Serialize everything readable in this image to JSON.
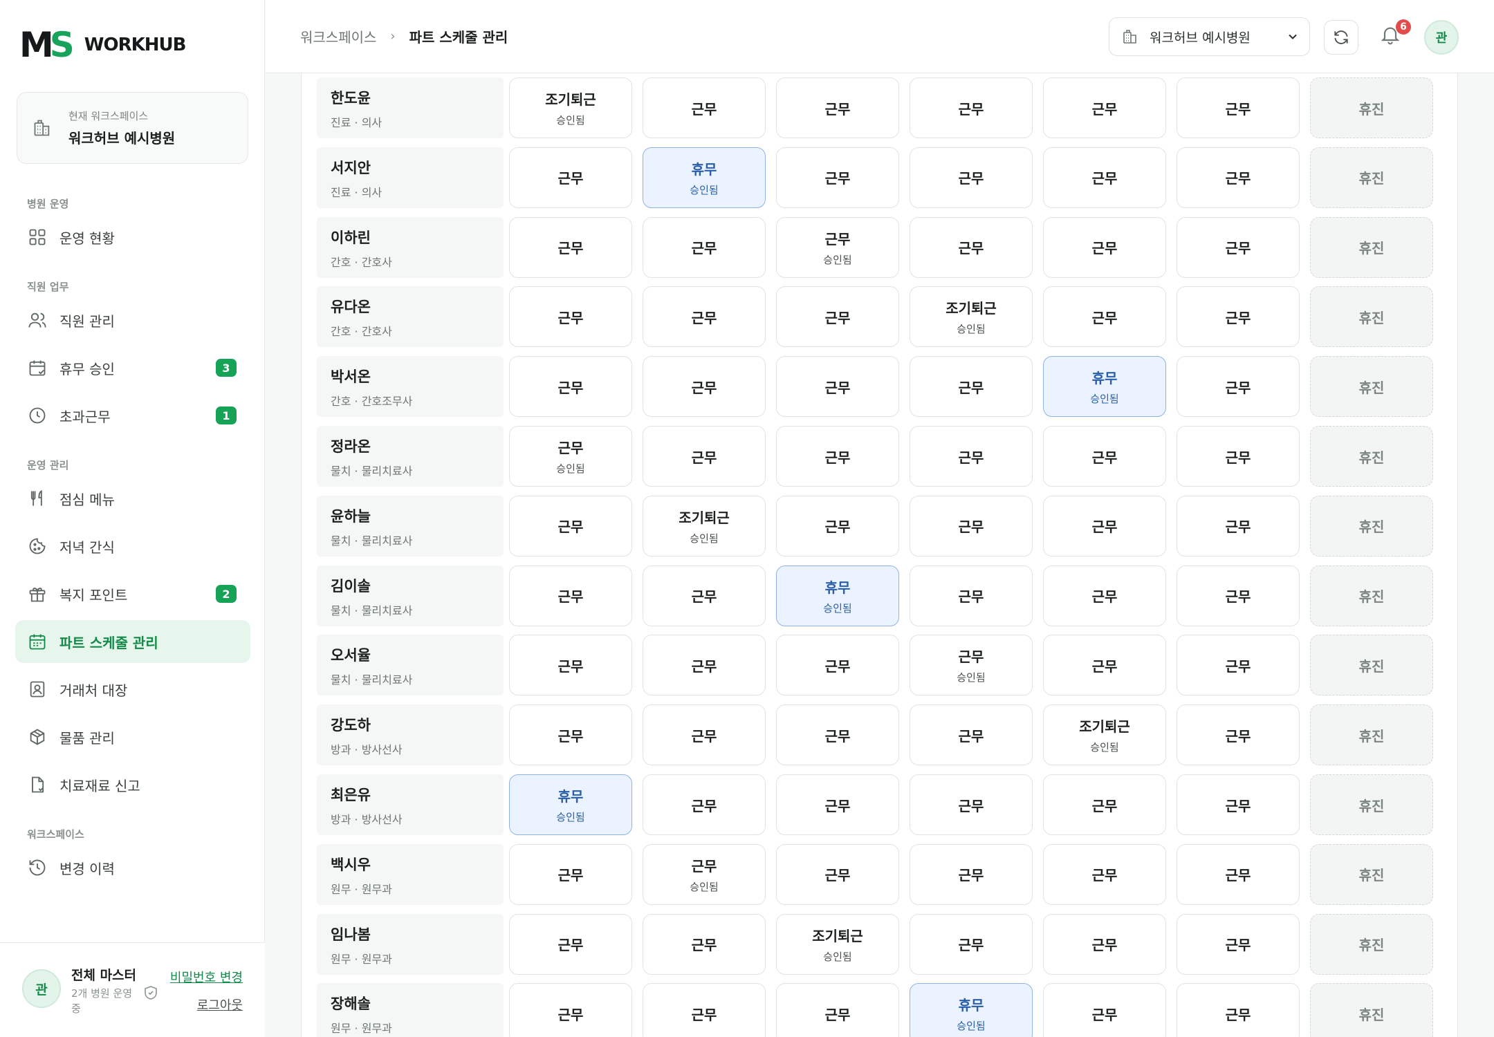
{
  "app": {
    "logo_mark_m": "M",
    "logo_mark_s": "S",
    "logo_text": "WORKHUB"
  },
  "workspace_card": {
    "label": "현재 워크스페이스",
    "value": "워크허브 예시병원"
  },
  "nav": {
    "sections": [
      {
        "title": "병원 운영",
        "items": [
          {
            "key": "dashboard",
            "label": "운영 현황",
            "icon": "grid-icon"
          }
        ]
      },
      {
        "title": "직원 업무",
        "items": [
          {
            "key": "staff",
            "label": "직원 관리",
            "icon": "users-icon"
          },
          {
            "key": "leave",
            "label": "휴무 승인",
            "icon": "calendar-check-icon",
            "badge": "3"
          },
          {
            "key": "overtime",
            "label": "초과근무",
            "icon": "clock-icon",
            "badge": "1"
          }
        ]
      },
      {
        "title": "운영 관리",
        "items": [
          {
            "key": "lunch",
            "label": "점심 메뉴",
            "icon": "utensils-icon"
          },
          {
            "key": "snack",
            "label": "저녁 간식",
            "icon": "cookie-icon"
          },
          {
            "key": "points",
            "label": "복지 포인트",
            "icon": "gift-icon",
            "badge": "2"
          },
          {
            "key": "schedule",
            "label": "파트 스케줄 관리",
            "icon": "calendar-icon",
            "active": true
          },
          {
            "key": "vendors",
            "label": "거래처 대장",
            "icon": "contact-book-icon"
          },
          {
            "key": "supplies",
            "label": "물품 관리",
            "icon": "package-icon"
          },
          {
            "key": "materials",
            "label": "치료재료 신고",
            "icon": "file-report-icon"
          }
        ]
      },
      {
        "title": "워크스페이스",
        "items": [
          {
            "key": "history",
            "label": "변경 이력",
            "icon": "history-icon"
          }
        ]
      }
    ]
  },
  "user": {
    "avatar": "관",
    "name": "전체 마스터",
    "sub": "2개 병원 운영 중",
    "change_password": "비밀번호 변경",
    "logout": "로그아웃"
  },
  "header": {
    "breadcrumb": [
      "워크스페이스",
      "파트 스케줄 관리"
    ],
    "breadcrumb_sep": "›",
    "workspace_select": "워크허브 예시병원",
    "notification_count": "6",
    "avatar": "관"
  },
  "labels": {
    "work": "근무",
    "leave": "휴무",
    "early": "조기퇴근",
    "off": "휴진",
    "approved": "승인됨"
  },
  "colors": {
    "accent": "#16a257",
    "leave_bg": "#eaf3ff",
    "leave_border": "#8fb3e6",
    "badge_red": "#e34b4b"
  },
  "schedule": [
    {
      "name": "한도윤",
      "dept": "진료 · 의사",
      "days": [
        "E",
        "W",
        "W",
        "W",
        "W",
        "W",
        "O"
      ]
    },
    {
      "name": "서지안",
      "dept": "진료 · 의사",
      "days": [
        "W",
        "L",
        "W",
        "W",
        "W",
        "W",
        "O"
      ]
    },
    {
      "name": "이하린",
      "dept": "간호 · 간호사",
      "days": [
        "W",
        "W",
        "WA",
        "W",
        "W",
        "W",
        "O"
      ]
    },
    {
      "name": "유다온",
      "dept": "간호 · 간호사",
      "days": [
        "W",
        "W",
        "W",
        "E",
        "W",
        "W",
        "O"
      ]
    },
    {
      "name": "박서온",
      "dept": "간호 · 간호조무사",
      "days": [
        "W",
        "W",
        "W",
        "W",
        "L",
        "W",
        "O"
      ]
    },
    {
      "name": "정라온",
      "dept": "물치 · 물리치료사",
      "days": [
        "WA",
        "W",
        "W",
        "W",
        "W",
        "W",
        "O"
      ]
    },
    {
      "name": "윤하늘",
      "dept": "물치 · 물리치료사",
      "days": [
        "W",
        "E",
        "W",
        "W",
        "W",
        "W",
        "O"
      ]
    },
    {
      "name": "김이솔",
      "dept": "물치 · 물리치료사",
      "days": [
        "W",
        "W",
        "L",
        "W",
        "W",
        "W",
        "O"
      ]
    },
    {
      "name": "오서율",
      "dept": "물치 · 물리치료사",
      "days": [
        "W",
        "W",
        "W",
        "WA",
        "W",
        "W",
        "O"
      ]
    },
    {
      "name": "강도하",
      "dept": "방과 · 방사선사",
      "days": [
        "W",
        "W",
        "W",
        "W",
        "E",
        "W",
        "O"
      ]
    },
    {
      "name": "최은유",
      "dept": "방과 · 방사선사",
      "days": [
        "L",
        "W",
        "W",
        "W",
        "W",
        "W",
        "O"
      ]
    },
    {
      "name": "백시우",
      "dept": "원무 · 원무과",
      "days": [
        "W",
        "WA",
        "W",
        "W",
        "W",
        "W",
        "O"
      ]
    },
    {
      "name": "임나봄",
      "dept": "원무 · 원무과",
      "days": [
        "W",
        "W",
        "E",
        "W",
        "W",
        "W",
        "O"
      ]
    },
    {
      "name": "장해솔",
      "dept": "원무 · 원무과",
      "days": [
        "W",
        "W",
        "W",
        "L",
        "W",
        "W",
        "O"
      ]
    }
  ]
}
